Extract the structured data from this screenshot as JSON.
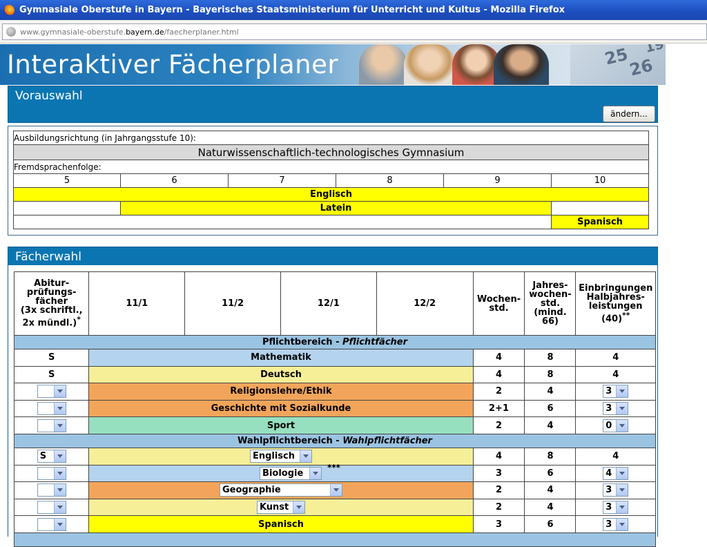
{
  "window": {
    "title": "Gymnasiale Oberstufe in Bayern - Bayerisches Staatsministerium für Unterricht und Kultus - Mozilla Firefox",
    "url_pre": "www.gymnasiale-oberstufe.",
    "url_host": "bayern.de",
    "url_post": "/faecherplaner.html"
  },
  "banner": {
    "title": "Interaktiver Fächerplaner",
    "cal_a": "25",
    "cal_b": "26",
    "cal_c": "19"
  },
  "vorauswahl": {
    "header": "Vorauswahl",
    "change_button": "ändern...",
    "ausbildung_label": "Ausbildungsrichtung (in Jahrgangsstufe 10):",
    "ausbildung_value": "Naturwissenschaftlich-technologisches Gymnasium",
    "fremdsprachen_label": "Fremdsprachenfolge:",
    "grades": [
      "5",
      "6",
      "7",
      "8",
      "9",
      "10"
    ],
    "lang1": "Englisch",
    "lang2": "Latein",
    "lang3": "Spanisch"
  },
  "faecherwahl": {
    "header": "Fächerwahl",
    "col_abitur": [
      "Abitur-",
      "prüfungs-",
      "fächer",
      "(3x schriftl.,",
      "2x mündl.)"
    ],
    "col_abitur_star": "*",
    "col_11_1": "11/1",
    "col_11_2": "11/2",
    "col_12_1": "12/1",
    "col_12_2": "12/2",
    "col_wochen": [
      "Wochen-",
      "std."
    ],
    "col_jahres": [
      "Jahres-",
      "wochen-",
      "std.",
      "(mind.",
      "66)"
    ],
    "col_einbr": [
      "Einbringungen",
      "Halbjahres-",
      "leistungen",
      "(40)"
    ],
    "col_einbr_star": "**",
    "pflicht_title": "Pflichtbereich - ",
    "pflicht_title_it": "Pflichtfächer",
    "wahl_title": "Wahlpflichtbereich - ",
    "wahl_title_it": "Wahlpflichtfächer",
    "rows": [
      {
        "abitur": "S",
        "subject": "Mathematik",
        "wochen": "4",
        "jahres": "8",
        "einbr": "4"
      },
      {
        "abitur": "S",
        "subject": "Deutsch",
        "wochen": "4",
        "jahres": "8",
        "einbr": "4"
      },
      {
        "abitur": "",
        "subject": "Religionslehre/Ethik",
        "wochen": "2",
        "jahres": "4",
        "einbr": "3"
      },
      {
        "abitur": "",
        "subject": "Geschichte mit Sozialkunde",
        "wochen": "2+1",
        "jahres": "6",
        "einbr": "3"
      },
      {
        "abitur": "",
        "subject": "Sport",
        "wochen": "2",
        "jahres": "4",
        "einbr": "0"
      },
      {
        "abitur": "S",
        "subject": "Englisch",
        "wochen": "4",
        "jahres": "8",
        "einbr": "4"
      },
      {
        "abitur": "",
        "subject": "Biologie",
        "stars": "***",
        "wochen": "3",
        "jahres": "6",
        "einbr": "4"
      },
      {
        "abitur": "",
        "subject": "Geographie",
        "wochen": "2",
        "jahres": "4",
        "einbr": "3"
      },
      {
        "abitur": "",
        "subject": "Kunst",
        "wochen": "2",
        "jahres": "4",
        "einbr": "3"
      },
      {
        "abitur": "",
        "subject": "Spanisch",
        "wochen": "3",
        "jahres": "6",
        "einbr": "3"
      }
    ]
  }
}
